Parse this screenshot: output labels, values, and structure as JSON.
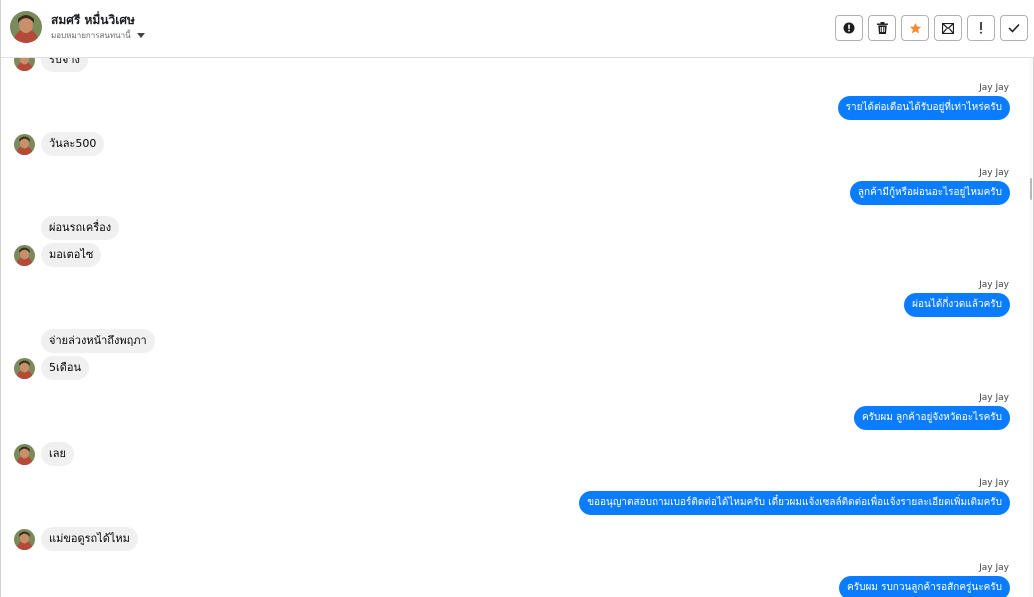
{
  "contact": {
    "name": "สมศรี หมื่นวิเศษ",
    "assign_label": "มอบหมายการสนทนานี้"
  },
  "colors": {
    "outgoing_bubble": "#0a7cff",
    "incoming_bubble": "#f0f0f0",
    "star_active": "#f5893a"
  },
  "actions": [
    {
      "icon": "alert-circle-icon",
      "label": "spam"
    },
    {
      "icon": "trash-icon",
      "label": "delete"
    },
    {
      "icon": "star-icon",
      "label": "star"
    },
    {
      "icon": "mail-icon",
      "label": "mark-unread"
    },
    {
      "icon": "exclamation-icon",
      "label": "follow-up"
    },
    {
      "icon": "check-icon",
      "label": "done"
    }
  ],
  "messages": [
    {
      "dir": "in",
      "text": "รับจ้าง",
      "avatar": true
    },
    {
      "dir": "out",
      "sender": "Jay Jay",
      "text": "รายได้ต่อเดือนได้รับอยู่ที่เท่าไหร่ครับ"
    },
    {
      "dir": "in",
      "text": "วันละ500",
      "avatar": true
    },
    {
      "dir": "out",
      "sender": "Jay Jay",
      "text": "ลูกค้ามีกู้หรือผ่อนอะไรอยู่ไหมครับ"
    },
    {
      "dir": "in",
      "text": "ผ่อนรถเครื่อง",
      "avatar": false
    },
    {
      "dir": "in",
      "text": "มอเตอไซ",
      "avatar": true
    },
    {
      "dir": "out",
      "sender": "Jay Jay",
      "text": "ผ่อนได้กี่งวดแล้วครับ"
    },
    {
      "dir": "in",
      "text": "จ่ายล่วงหน้าถึงพฤภา",
      "avatar": false
    },
    {
      "dir": "in",
      "text": "5เดือน",
      "avatar": true
    },
    {
      "dir": "out",
      "sender": "Jay Jay",
      "text": "ครับผม ลูกค้าอยู่จังหวัดอะไรครับ"
    },
    {
      "dir": "in",
      "text": "เลย",
      "avatar": true
    },
    {
      "dir": "out",
      "sender": "Jay Jay",
      "text": "ขออนุญาตสอบถามเบอร์ติดต่อได้ไหมครับ เดี๋ยวผมแจ้งเซลล์ติดต่อเพื่อแจ้งรายละเอียดเพิ่มเติมครับ"
    },
    {
      "dir": "in",
      "text": "แม่ขอดูรถได้ไหม",
      "avatar": true
    },
    {
      "dir": "out",
      "sender": "Jay Jay",
      "text": "ครับผม รบกวนลูกค้ารอสักครู่นะครับ"
    }
  ]
}
